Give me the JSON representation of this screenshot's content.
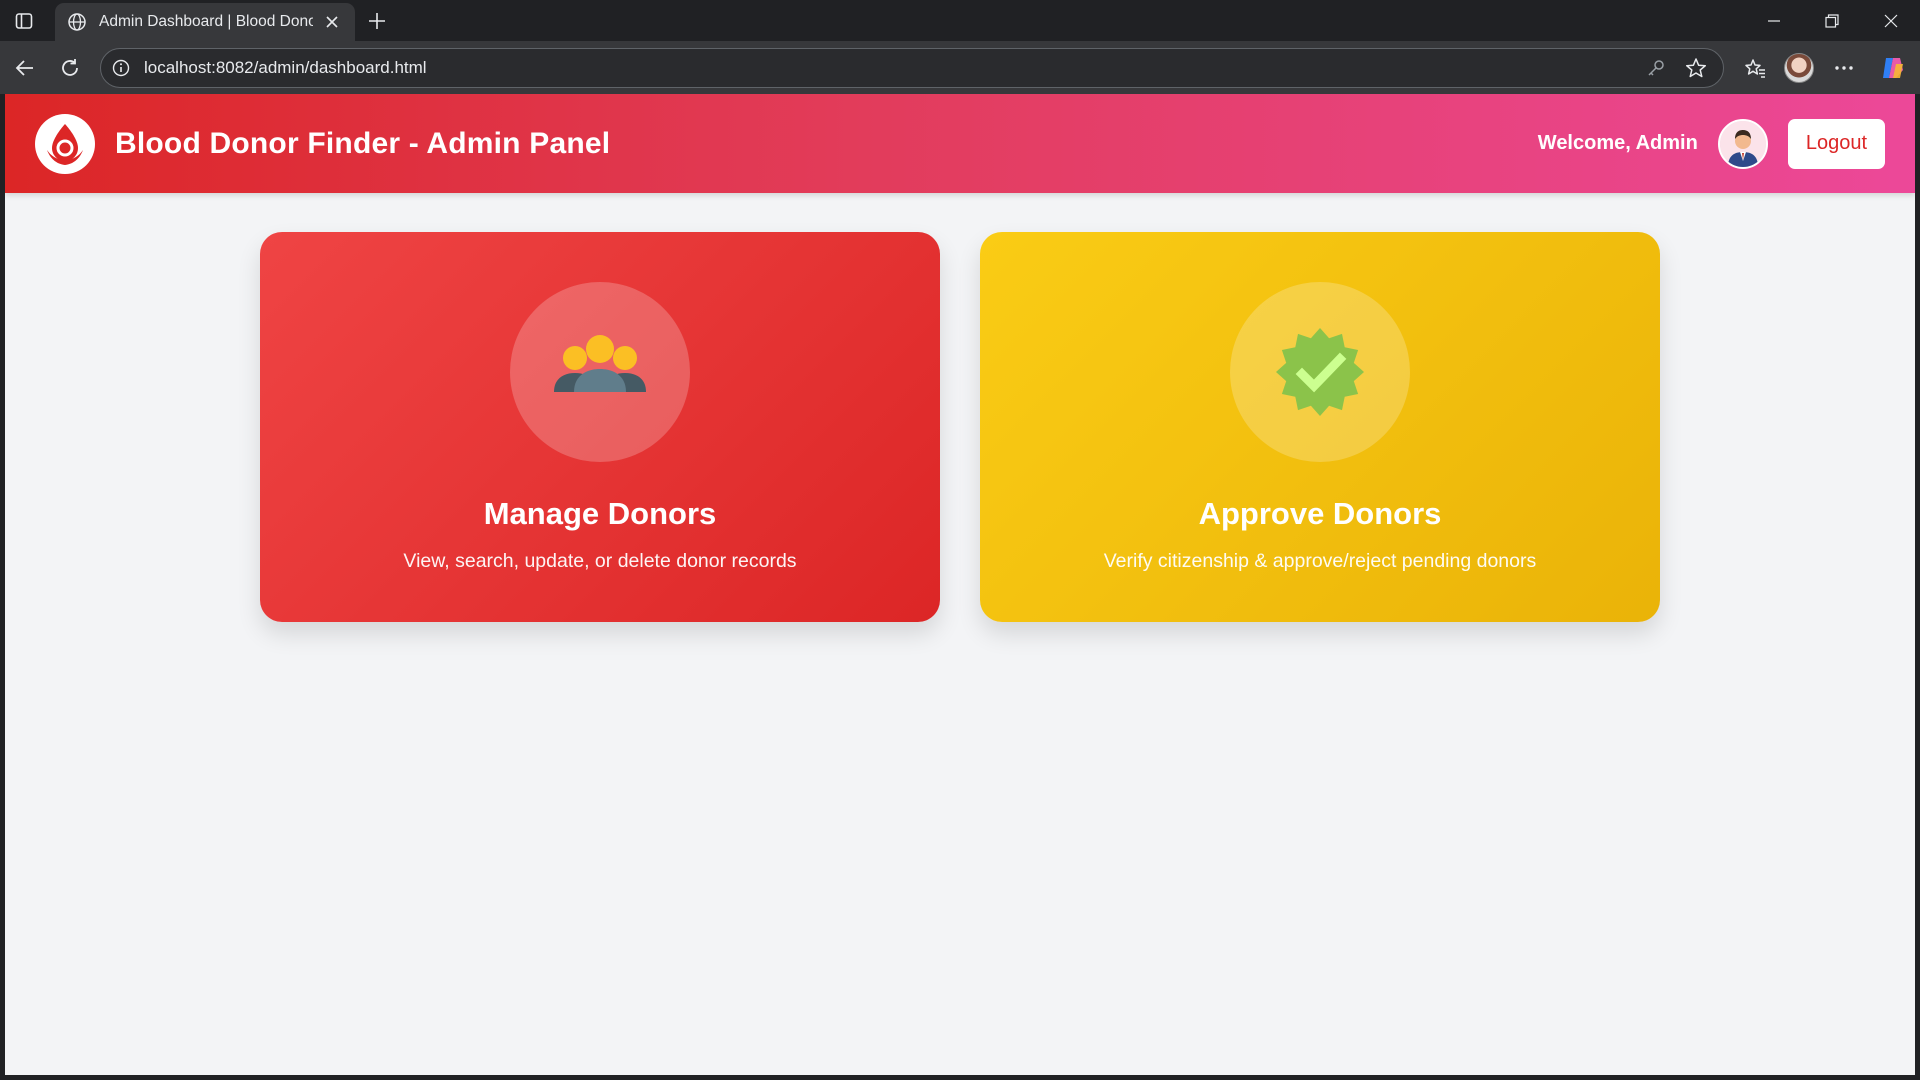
{
  "browser": {
    "tab_title": "Admin Dashboard | Blood Donor Finder",
    "url": "localhost:8082/admin/dashboard.html"
  },
  "header": {
    "title": "Blood Donor Finder - Admin Panel",
    "welcome": "Welcome, Admin",
    "logout_label": "Logout"
  },
  "cards": [
    {
      "title": "Manage Donors",
      "description": "View, search, update, or delete donor records",
      "icon": "users-group-icon",
      "color": "#ef4444"
    },
    {
      "title": "Approve Donors",
      "description": "Verify citizenship & approve/reject pending donors",
      "icon": "verified-badge-icon",
      "color": "#facc15"
    }
  ],
  "colors": {
    "header_start": "#dc2626",
    "header_end": "#ec4899",
    "page_bg": "#f3f4f6"
  }
}
